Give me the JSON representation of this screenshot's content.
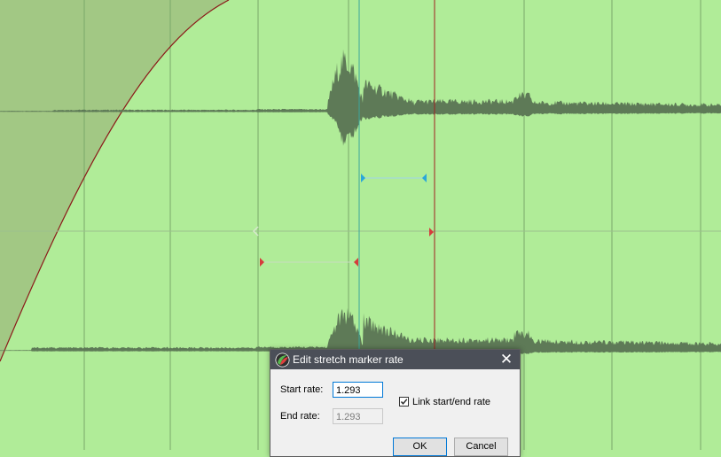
{
  "dialog": {
    "title": "Edit stretch marker rate",
    "start_rate_label": "Start rate:",
    "start_rate_value": "1.293",
    "end_rate_label": "End rate:",
    "end_rate_value": "1.293",
    "link_label": "Link start/end rate",
    "link_checked": true,
    "ok_label": "OK",
    "cancel_label": "Cancel",
    "close_glyph": "✕"
  },
  "colors": {
    "background": "#b0ec98",
    "fade_fill": "#a2c884",
    "envelope": "#8b1a1a",
    "waveform": "#5e7a57",
    "gridline": "#7aa86a",
    "cursor_teal": "#3aa69c",
    "marker_red": "#d53c3c",
    "marker_cyan": "#2aa7d9",
    "titlebar": "#4b4f58"
  },
  "icons": {
    "app": "reaper-logo-icon",
    "close": "close-icon",
    "checkbox": "checkmark-icon",
    "stretch_marker_left": "stretch-marker-icon",
    "stretch_marker_right": "stretch-marker-icon"
  }
}
